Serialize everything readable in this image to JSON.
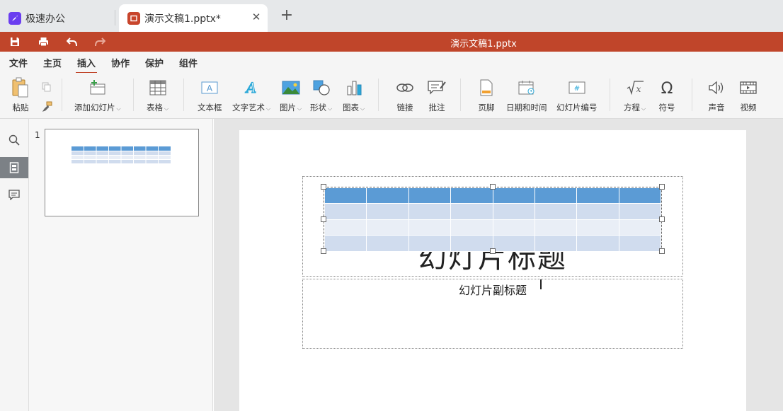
{
  "tabs": {
    "home_label": "极速办公",
    "doc_label": "演示文稿1.pptx*",
    "close_symbol": "✕",
    "add_symbol": "+"
  },
  "titlebar": {
    "title": "演示文稿1.pptx",
    "accent_color": "#c0452a"
  },
  "menu": {
    "items": [
      "文件",
      "主页",
      "插入",
      "协作",
      "保护",
      "组件"
    ],
    "active": "插入"
  },
  "ribbon": {
    "paste": "粘贴",
    "add_slide": "添加幻灯片",
    "table": "表格",
    "textbox": "文本框",
    "wordart": "文字艺术",
    "image": "图片",
    "shape": "形状",
    "chart": "图表",
    "link": "链接",
    "comment": "批注",
    "footer": "页脚",
    "datetime": "日期和时间",
    "slide_number": "幻灯片编号",
    "equation": "方程",
    "symbol": "符号",
    "audio": "声音",
    "video": "视频"
  },
  "thumbs": {
    "slide_number": "1"
  },
  "slide": {
    "title": "幻灯片标题",
    "subtitle": "幻灯片副标题",
    "table_header_color": "#5b9bd5",
    "table_row_color_a": "#d0dcee",
    "table_row_color_b": "#e9eef6"
  }
}
